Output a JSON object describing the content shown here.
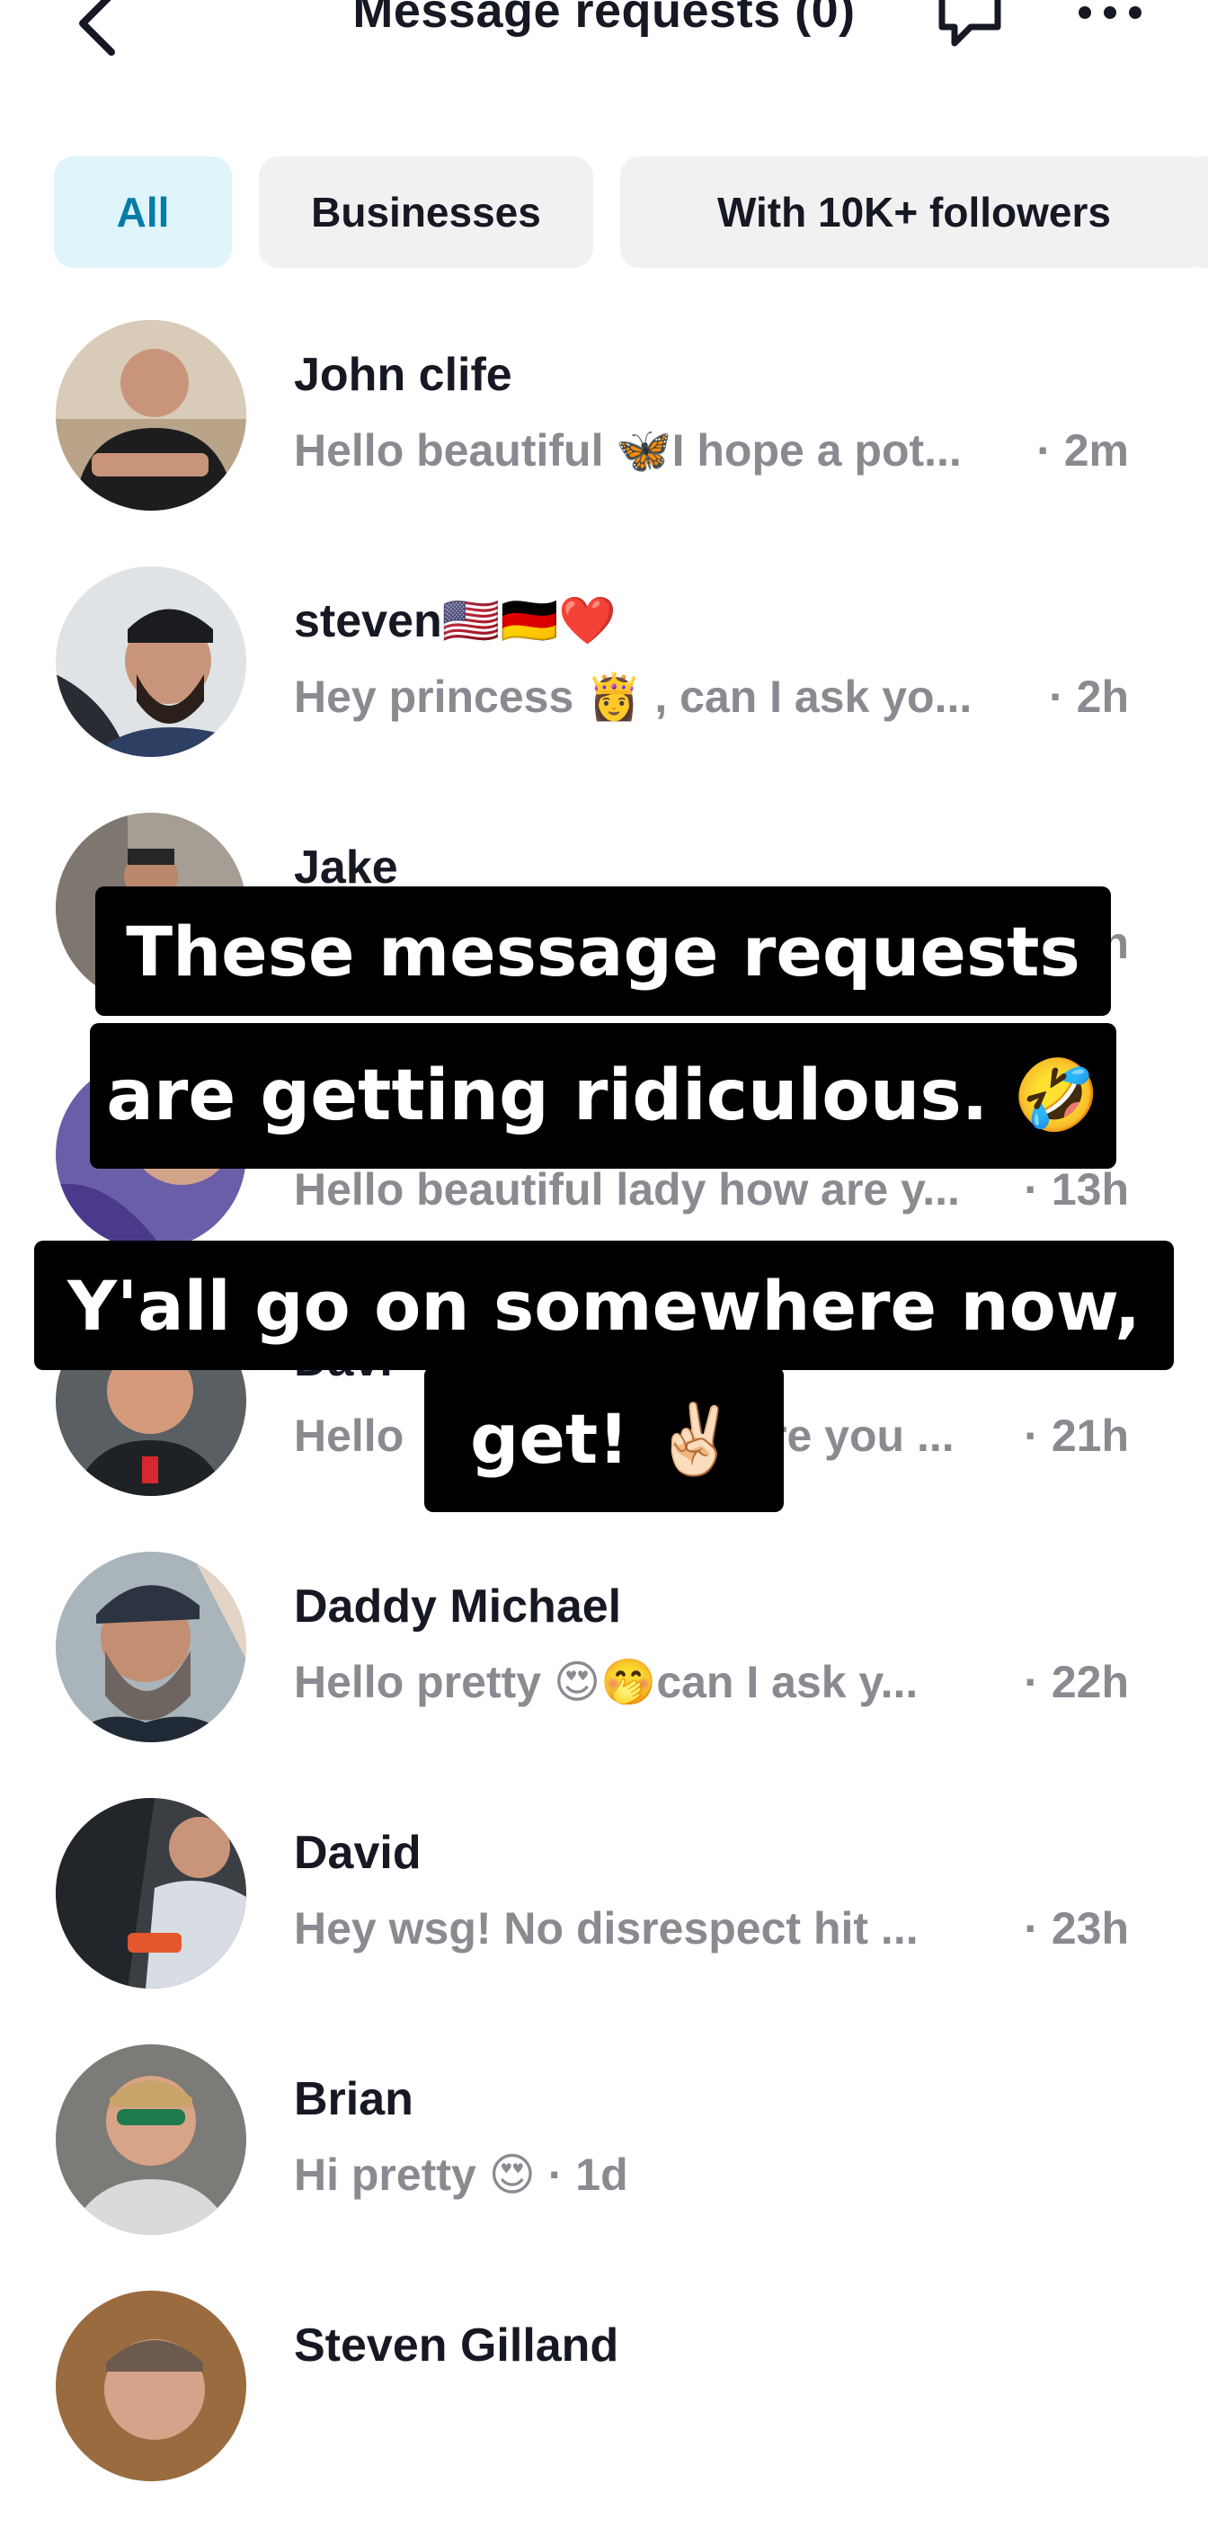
{
  "header": {
    "title": "Message requests (0)"
  },
  "filters": [
    {
      "label": "All",
      "active": true
    },
    {
      "label": "Businesses",
      "active": false
    },
    {
      "label": "With 10K+ followers",
      "active": false
    }
  ],
  "requests": [
    {
      "name": "John clife",
      "preview": "Hello beautiful 🦋I hope a pot...",
      "time": "· 2m"
    },
    {
      "name": "steven🇺🇸🇩🇪❤️",
      "preview": "Hey princess 👸 , can I ask yo...",
      "time": "· 2h"
    },
    {
      "name": "Jake",
      "preview": "",
      "time": "h"
    },
    {
      "name": "",
      "preview": "Hello beautiful lady how are y...",
      "time": "· 13h"
    },
    {
      "name": "Davi",
      "preview": "Hello",
      "preview_tail": "re you ...",
      "time": "· 21h"
    },
    {
      "name": "Daddy Michael",
      "preview": "Hello pretty 😍🤭can I ask y...",
      "time": "· 22h"
    },
    {
      "name": "David",
      "preview": "Hey wsg! No disrespect hit ...",
      "time": "· 23h"
    },
    {
      "name": "Brian",
      "preview": "Hi pretty 😍 · 1d",
      "time": ""
    },
    {
      "name": "Steven Gilland",
      "preview": "",
      "time": ""
    }
  ],
  "captions": {
    "line1": "These message requests",
    "line2": "are getting ridiculous. 🤣",
    "line3": "Y'all go on somewhere now,",
    "line4": "get! ✌🏻"
  }
}
